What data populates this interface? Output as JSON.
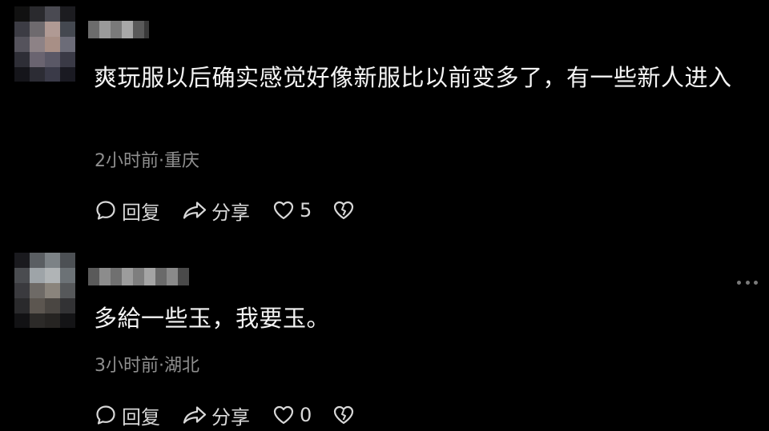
{
  "comments": [
    {
      "text": "爽玩服以后确实感觉好像新服比以前变多了，有一些新人进入",
      "time_location": "2小时前·重庆",
      "reply_label": "回复",
      "share_label": "分享",
      "like_count": "5"
    },
    {
      "text": "多給一些玉，我要玉。",
      "time_location": "3小时前·湖北",
      "reply_label": "回复",
      "share_label": "分享",
      "like_count": "0"
    }
  ],
  "colors": {
    "background": "#000000",
    "text": "#f4f4f4",
    "meta": "#8f8f8f",
    "action": "#d8d8d8"
  },
  "icons": [
    "comment-bubble-icon",
    "share-arrow-icon",
    "heart-icon",
    "broken-heart-icon",
    "more-dots-icon"
  ]
}
